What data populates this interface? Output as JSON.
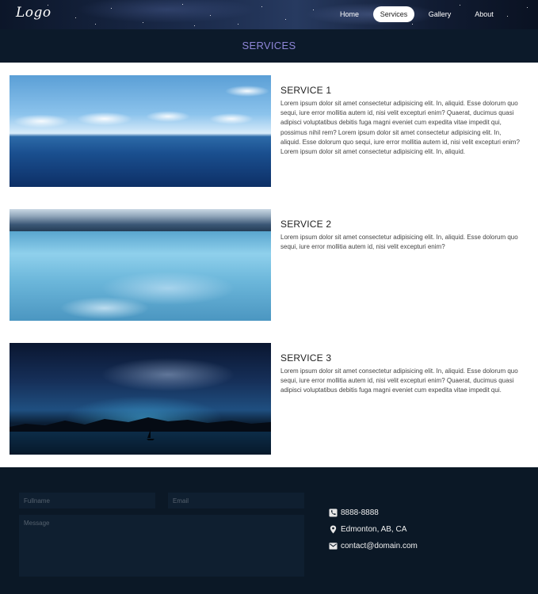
{
  "nav": {
    "logo": "Logo",
    "links": [
      {
        "label": "Home",
        "active": false
      },
      {
        "label": "Services",
        "active": true
      },
      {
        "label": "Gallery",
        "active": false
      },
      {
        "label": "About",
        "active": false
      }
    ]
  },
  "page": {
    "title": "SERVICES"
  },
  "services": [
    {
      "title": "SERVICE 1",
      "image_icon": "ocean-image",
      "text": "Lorem ipsum dolor sit amet consectetur adipisicing elit. In, aliquid. Esse dolorum quo sequi, iure error mollitia autem id, nisi velit excepturi enim? Quaerat, ducimus quasi adipisci voluptatibus debitis fuga magni eveniet cum expedita vitae impedit qui, possimus nihil rem? Lorem ipsum dolor sit amet consectetur adipisicing elit. In, aliquid. Esse dolorum quo sequi, iure error mollitia autem id, nisi velit excepturi enim?Lorem ipsum dolor sit amet consectetur adipisicing elit. In, aliquid."
    },
    {
      "title": "SERVICE 2",
      "image_icon": "lake-image",
      "text": "Lorem ipsum dolor sit amet consectetur adipisicing elit. In, aliquid. Esse dolorum quo sequi, iure error mollitia autem id, nisi velit excepturi enim?"
    },
    {
      "title": "SERVICE 3",
      "image_icon": "night-sky-image",
      "text": "Lorem ipsum dolor sit amet consectetur adipisicing elit. In, aliquid. Esse dolorum quo sequi, iure error mollitia autem id, nisi velit excepturi enim? Quaerat, ducimus quasi adipisci voluptatibus debitis fuga magni eveniet cum expedita vitae impedit qui."
    }
  ],
  "form": {
    "fullname_placeholder": "Fullname",
    "email_placeholder": "Email",
    "message_placeholder": "Message"
  },
  "contact": {
    "phone": "8888-8888",
    "location": "Edmonton, AB, CA",
    "email": "contact@domain.com"
  },
  "colors": {
    "band_bg": "#0c1a2a",
    "band_title": "#8f86d8",
    "footer_bg": "#0b1826",
    "field_bg": "#0f1f30"
  }
}
